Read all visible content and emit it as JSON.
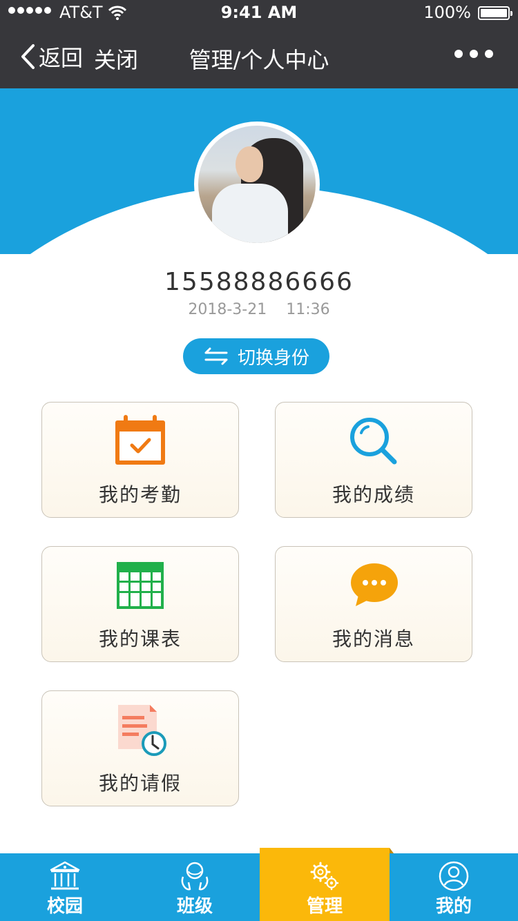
{
  "status_bar": {
    "carrier": "AT&T",
    "time": "9:41 AM",
    "battery": "100%"
  },
  "nav": {
    "back_label": "返回",
    "close_label": "关闭",
    "title": "管理/个人中心"
  },
  "profile": {
    "phone": "15588886666",
    "date": "2018-3-21",
    "time": "11:36",
    "switch_label": "切换身份"
  },
  "menu": [
    {
      "label": "我的考勤",
      "icon": "calendar-check-icon",
      "color": "#f07a13"
    },
    {
      "label": "我的成绩",
      "icon": "search-icon",
      "color": "#1aa1dd"
    },
    {
      "label": "我的课表",
      "icon": "timetable-icon",
      "color": "#21b04b"
    },
    {
      "label": "我的消息",
      "icon": "chat-bubble-icon",
      "color": "#f5a30b"
    },
    {
      "label": "我的请假",
      "icon": "leave-request-icon",
      "color": "#f47c5f"
    }
  ],
  "tabs": [
    {
      "label": "校园",
      "icon": "campus-icon"
    },
    {
      "label": "班级",
      "icon": "class-icon"
    },
    {
      "label": "管理",
      "icon": "gears-icon",
      "active": true
    },
    {
      "label": "我的",
      "icon": "user-icon"
    }
  ],
  "colors": {
    "primary": "#1aa1dd",
    "active_tab": "#fbb80a",
    "top_bar": "#37373b"
  }
}
